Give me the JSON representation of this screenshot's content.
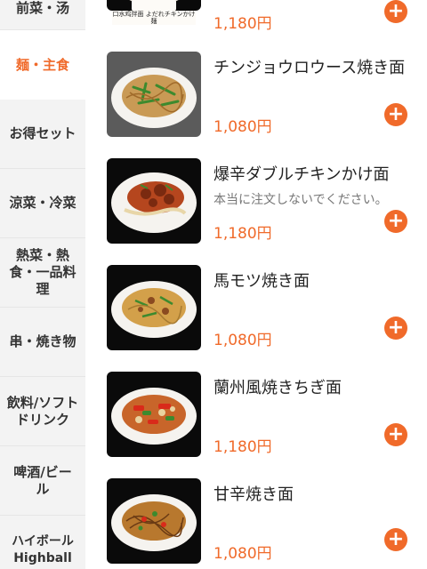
{
  "sidebar": {
    "categories": [
      {
        "label": "前菜・汤"
      },
      {
        "label": "麺・主食"
      },
      {
        "label": "お得セット"
      },
      {
        "label": "涼菜・冷菜"
      },
      {
        "label": "熱菜・熱食・一品料理"
      },
      {
        "label": "串・焼き物"
      },
      {
        "label": "飲料/ソフトドリンク"
      },
      {
        "label": "啤酒/ビール"
      },
      {
        "label": "ハイボール Highball"
      }
    ],
    "active_index": 1
  },
  "items": [
    {
      "name": "",
      "price": "1,180円",
      "note": "",
      "banner_text": "口水鸡拌面 よだれチキンかけ麺"
    },
    {
      "name": "チンジョウロウース焼き面",
      "price": "1,080円",
      "note": ""
    },
    {
      "name": "爆辛ダブルチキンかけ面",
      "price": "1,180円",
      "note": "本当に注文しないでください。"
    },
    {
      "name": "馬モツ焼き面",
      "price": "1,080円",
      "note": ""
    },
    {
      "name": "蘭州風焼きちぎ面",
      "price": "1,180円",
      "note": ""
    },
    {
      "name": "甘辛焼き面",
      "price": "1,080円",
      "note": ""
    }
  ],
  "add_icon": "plus-circle-icon",
  "colors": {
    "accent": "#f06a2a",
    "sidebar_bg": "#f3f3f3"
  }
}
